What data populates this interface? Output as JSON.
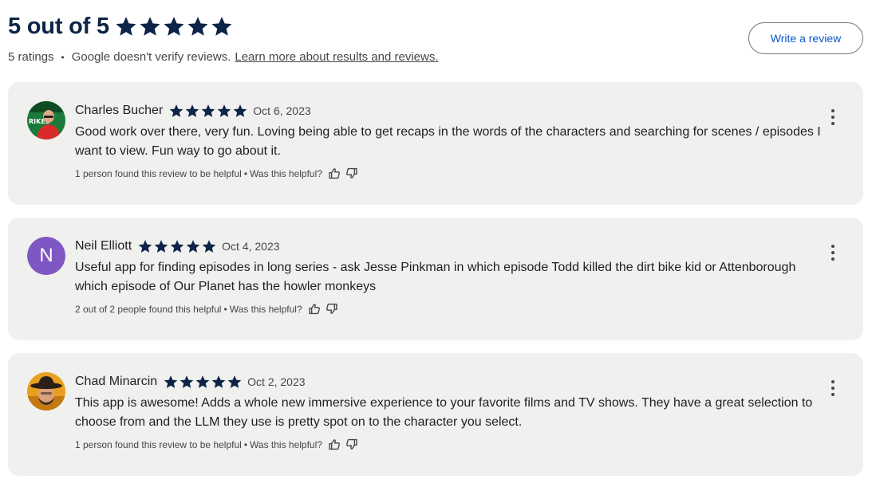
{
  "summary": {
    "score_text": "5 out of 5",
    "rating": 5,
    "ratings_count": "5 ratings",
    "separator": "•",
    "disclaimer": "Google doesn't verify reviews.",
    "learn_more": "Learn more about results and reviews."
  },
  "write_review_label": "Write a review",
  "colors": {
    "star": "#0b2447",
    "card_bg": "#f0f0ef",
    "link_blue": "#0b57d0",
    "avatar_purple": "#7e57c2"
  },
  "reviews": [
    {
      "name": "Charles Bucher",
      "rating": 5,
      "date": "Oct 6, 2023",
      "text": "Good work over there, very fun. Loving being able to get recaps in the words of the characters and searching for scenes / episodes I want to view. Fun way to go about it.",
      "helpful_count": "1 person found this review to be helpful",
      "separator": "•",
      "helpful_prompt": "Was this helpful?",
      "avatar": "photo",
      "avatar_text": "RIKES"
    },
    {
      "name": "Neil Elliott",
      "rating": 5,
      "date": "Oct 4, 2023",
      "text": "Useful app for finding episodes in long series - ask Jesse Pinkman in which episode Todd killed the dirt bike kid or Attenborough which episode of Our Planet has the howler monkeys",
      "helpful_count": "2 out of 2 people found this helpful",
      "separator": "•",
      "helpful_prompt": "Was this helpful?",
      "avatar": "letter",
      "avatar_letter": "N"
    },
    {
      "name": "Chad Minarcin",
      "rating": 5,
      "date": "Oct 2, 2023",
      "text": "This app is awesome! Adds a whole new immersive experience to your favorite films and TV shows. They have a great selection to choose from and the LLM they use is pretty spot on to the character you select.",
      "helpful_count": "1 person found this review to be helpful",
      "separator": "•",
      "helpful_prompt": "Was this helpful?",
      "avatar": "photo"
    }
  ],
  "icons": [
    "star-icon",
    "thumbs-up-icon",
    "thumbs-down-icon",
    "more-vert-icon"
  ]
}
